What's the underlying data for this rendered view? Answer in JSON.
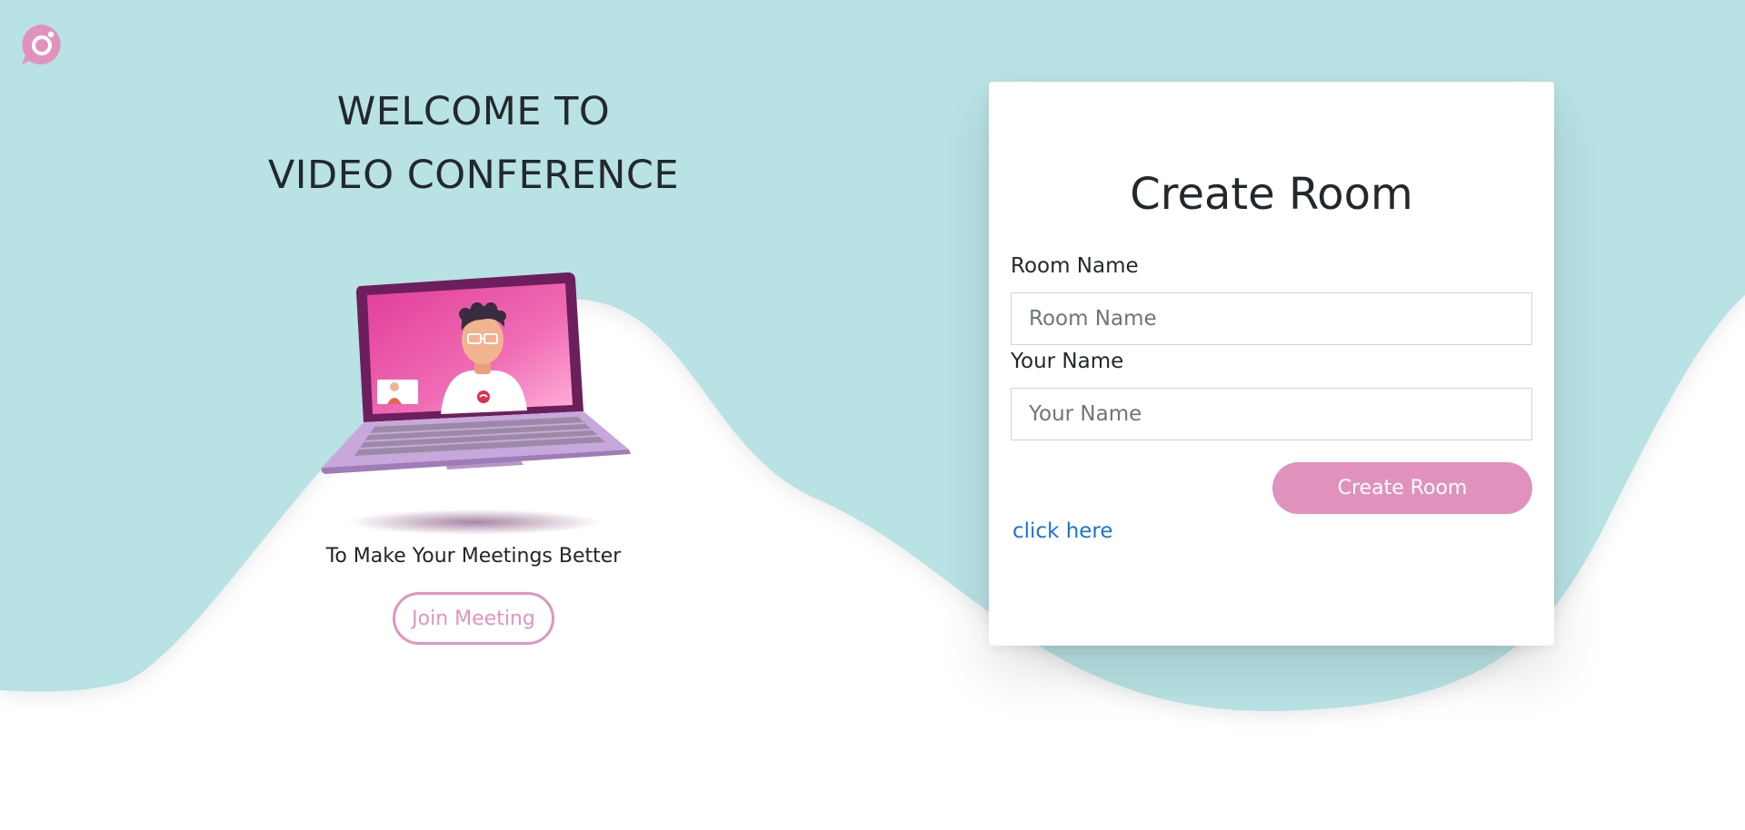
{
  "hero": {
    "title_line1": "WELCOME TO",
    "title_line2": "VIDEO CONFERENCE",
    "tagline": "To Make Your Meetings Better",
    "join_button": "Join Meeting"
  },
  "form": {
    "title": "Create Room",
    "room_name_label": "Room Name",
    "room_name_placeholder": "Room Name",
    "room_name_value": "",
    "your_name_label": "Your Name",
    "your_name_placeholder": "Your Name",
    "your_name_value": "",
    "submit_button": "Create Room",
    "link_text": "click here"
  },
  "icons": {
    "logo": "chat-bubble-camera-icon",
    "illustration": "laptop-video-call-illustration"
  },
  "colors": {
    "background_teal": "#b8e2e4",
    "accent_pink": "#e092bd",
    "link_blue": "#1a73d6",
    "heading_text": "#22282b"
  }
}
